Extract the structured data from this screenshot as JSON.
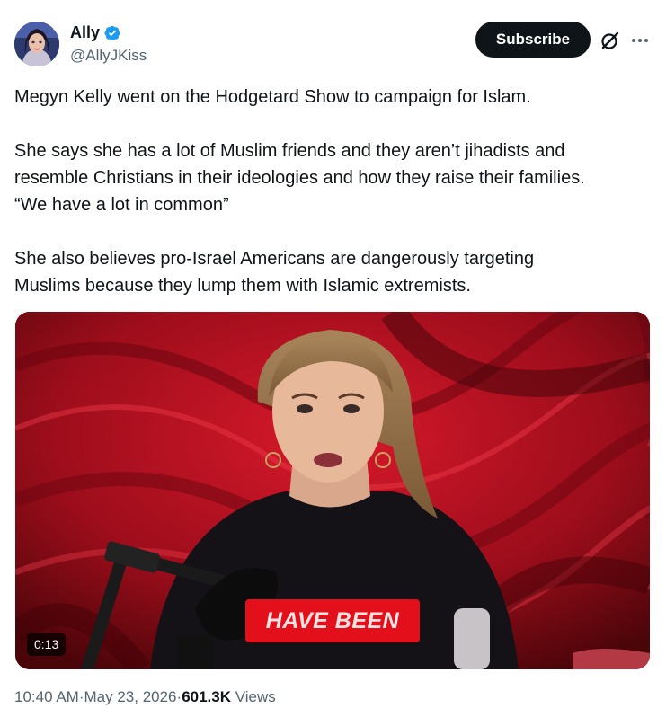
{
  "author": {
    "display_name": "Ally",
    "handle": "@AllyJKiss",
    "verified": true,
    "verified_color": "#1d9bf0",
    "avatar_icon": "avatar"
  },
  "actions": {
    "subscribe_label": "Subscribe",
    "grok_icon": "grok-icon",
    "more_icon": "more-icon"
  },
  "post": {
    "paragraph1": "Megyn Kelly went on the Hodgetard Show to campaign for Islam.",
    "paragraph2_line1": "She says she has a lot of Muslim friends and they aren’t jihadists and",
    "paragraph2_line2": "resemble Christians in their ideologies and how they raise their families.",
    "paragraph2_line3": "“We have a lot in common”",
    "paragraph3_line1": "She also believes pro-Israel Americans are dangerously targeting",
    "paragraph3_line2": "Muslims because they lump them with Islamic extremists."
  },
  "media": {
    "type": "video",
    "caption_text": "HAVE BEEN",
    "duration_label": "0:13",
    "background_color": "#b3121f"
  },
  "meta": {
    "time": "10:40 AM",
    "separator": " · ",
    "date": "May 23, 2026",
    "views_count": "601.3K",
    "views_label": "Views"
  },
  "colors": {
    "text_primary": "#0f1419",
    "text_secondary": "#536471",
    "button_dark": "#0f1419"
  }
}
